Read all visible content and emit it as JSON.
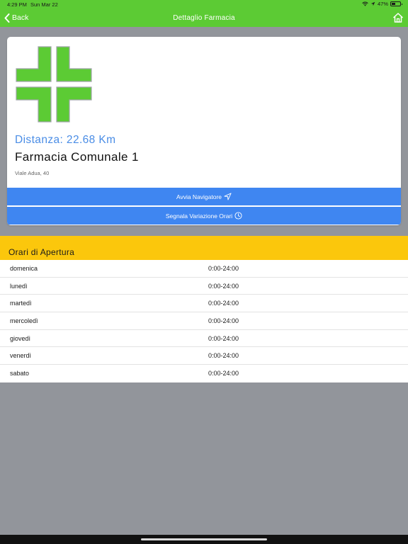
{
  "status_bar": {
    "time": "4:29 PM",
    "date": "Sun Mar 22",
    "battery": "47%",
    "battery_level": 0.47
  },
  "nav": {
    "back_label": "Back",
    "title": "Dettaglio Farmacia",
    "home_icon": "home-icon"
  },
  "pharmacy": {
    "distance": "Distanza: 22.68 Km",
    "name": "Farmacia Comunale 1",
    "address": "Viale Adua, 40",
    "logo_color": "#5ccb34"
  },
  "actions": {
    "navigate_label": "Avvia Navigatore",
    "navigate_icon": "navigation-arrow-icon",
    "report_label": "Segnala Variazione Orari",
    "report_icon": "clock-icon"
  },
  "hours": {
    "title": "Orari di Apertura",
    "rows": [
      {
        "day": "domenica",
        "time": "0:00-24:00"
      },
      {
        "day": "lunedì",
        "time": "0:00-24:00"
      },
      {
        "day": "martedì",
        "time": "0:00-24:00"
      },
      {
        "day": "mercoledì",
        "time": "0:00-24:00"
      },
      {
        "day": "giovedì",
        "time": "0:00-24:00"
      },
      {
        "day": "venerdì",
        "time": "0:00-24:00"
      },
      {
        "day": "sabato",
        "time": "0:00-24:00"
      }
    ]
  },
  "colors": {
    "nav_bar": "#5ccb34",
    "accent_blue": "#3f86f1",
    "hours_header": "#fbc70c",
    "background": "#92959b"
  }
}
